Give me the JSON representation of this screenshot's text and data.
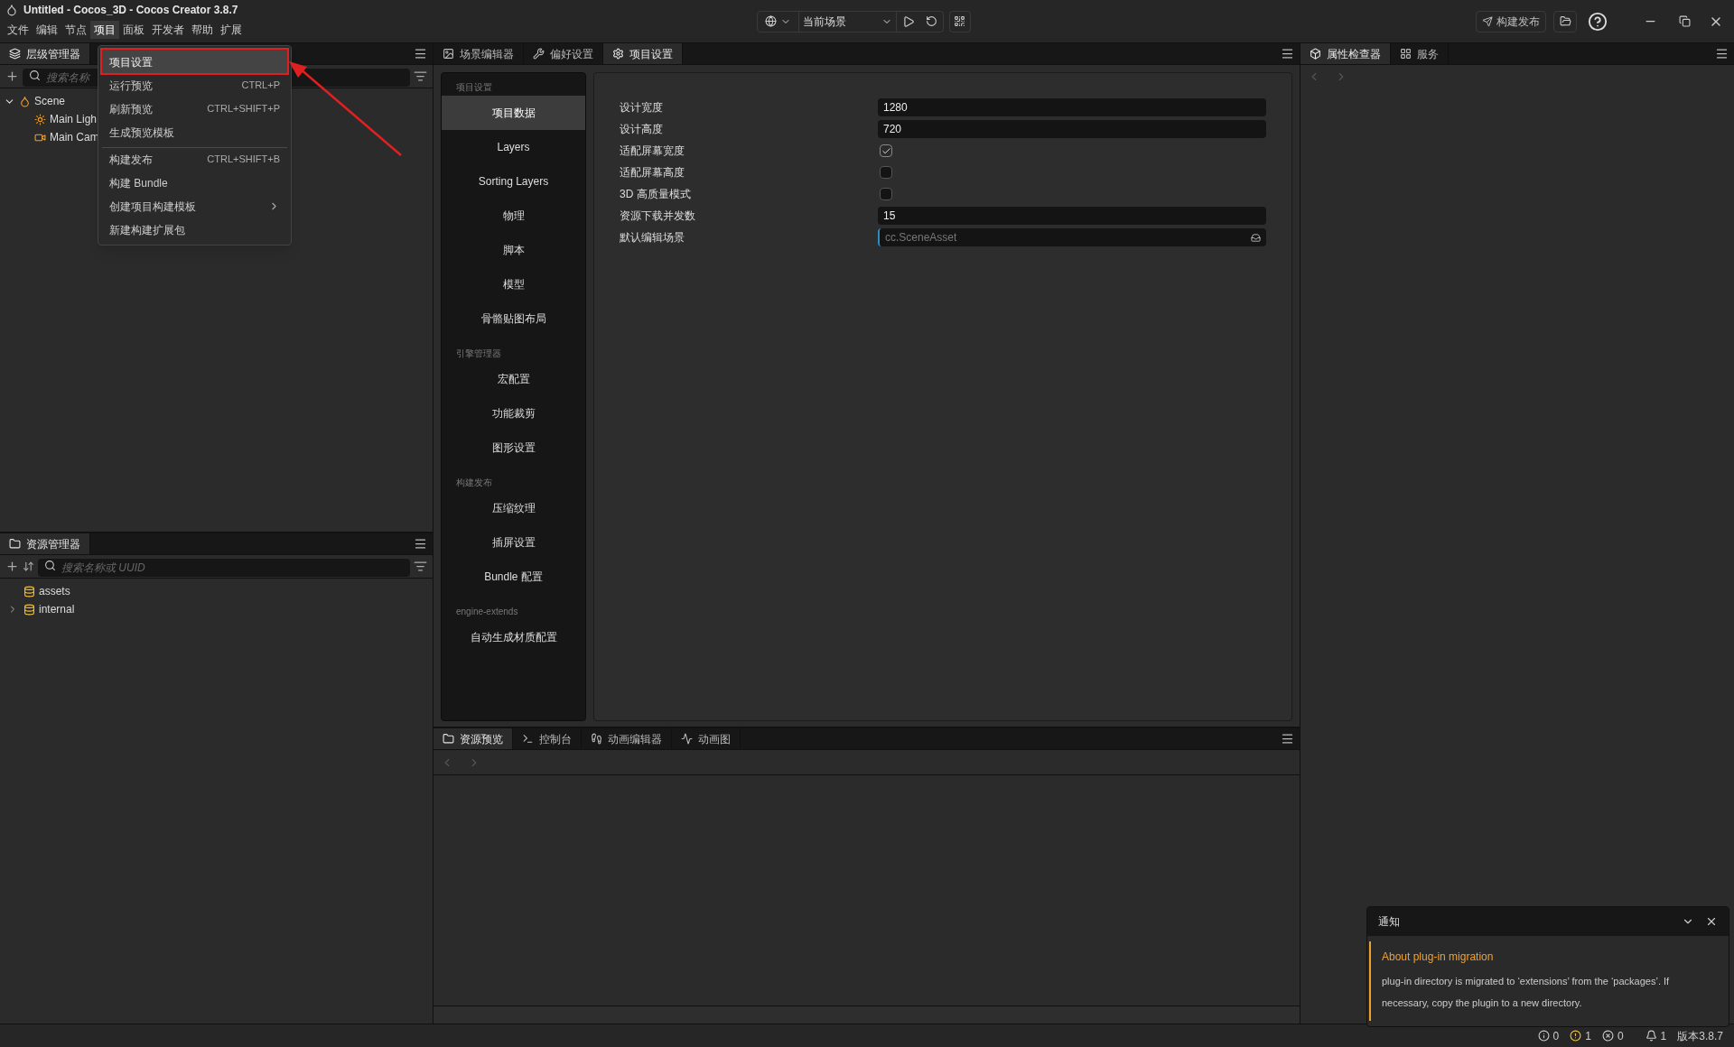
{
  "window": {
    "title": "Untitled - Cocos_3D - Cocos Creator 3.8.7"
  },
  "menu_bar": [
    {
      "label": "文件",
      "selected": false
    },
    {
      "label": "编辑",
      "selected": false
    },
    {
      "label": "节点",
      "selected": false
    },
    {
      "label": "项目",
      "selected": true
    },
    {
      "label": "面板",
      "selected": false
    },
    {
      "label": "开发者",
      "selected": false
    },
    {
      "label": "帮助",
      "selected": false
    },
    {
      "label": "扩展",
      "selected": false
    }
  ],
  "toolbar": {
    "scene_select": "当前场景",
    "build_button": "构建发布"
  },
  "project_menu": [
    {
      "label": "项目设置",
      "selected": true,
      "highlighted": true,
      "has_submenu": false,
      "separator_before": false
    },
    {
      "label": "运行预览",
      "shortcut": "CTRL+P",
      "selected": false,
      "highlighted": false,
      "has_submenu": false,
      "separator_before": false
    },
    {
      "label": "刷新预览",
      "shortcut": "CTRL+SHIFT+P",
      "selected": false,
      "highlighted": false,
      "has_submenu": false,
      "separator_before": false
    },
    {
      "label": "生成预览模板",
      "selected": false,
      "highlighted": false,
      "has_submenu": false,
      "separator_before": false
    },
    {
      "label": "构建发布",
      "shortcut": "CTRL+SHIFT+B",
      "selected": false,
      "highlighted": false,
      "has_submenu": false,
      "separator_before": true
    },
    {
      "label": "构建 Bundle",
      "selected": false,
      "highlighted": false,
      "has_submenu": false,
      "separator_before": false
    },
    {
      "label": "创建项目构建模板",
      "selected": false,
      "highlighted": false,
      "has_submenu": true,
      "separator_before": false
    },
    {
      "label": "新建构建扩展包",
      "selected": false,
      "highlighted": false,
      "has_submenu": false,
      "separator_before": false
    }
  ],
  "hierarchy": {
    "tabs": [
      {
        "label": "层级管理器",
        "selected": true
      }
    ],
    "search": {
      "placeholder": "搜索名称"
    },
    "tree": [
      {
        "label": "Scene",
        "kind": "scene",
        "expanded": true,
        "children": [
          {
            "label": "Main Ligh",
            "kind": "light"
          },
          {
            "label": "Main Cam",
            "kind": "camera"
          }
        ]
      }
    ]
  },
  "assets": {
    "tabs": [
      {
        "label": "资源管理器",
        "selected": true
      }
    ],
    "search": {
      "placeholder": "搜索名称或 UUID"
    },
    "tree": [
      {
        "label": "assets",
        "expandable": false
      },
      {
        "label": "internal",
        "expandable": true
      }
    ]
  },
  "editor": {
    "tabs": [
      {
        "label": "场景编辑器",
        "kind": "scene",
        "selected": false
      },
      {
        "label": "偏好设置",
        "kind": "prefs",
        "selected": false
      },
      {
        "label": "项目设置",
        "kind": "settings",
        "selected": true
      }
    ],
    "nav": [
      {
        "heading": "项目设置",
        "items": [
          {
            "label": "项目数据",
            "selected": true
          },
          {
            "label": "Layers",
            "selected": false
          },
          {
            "label": "Sorting Layers",
            "selected": false
          },
          {
            "label": "物理",
            "selected": false
          },
          {
            "label": "脚本",
            "selected": false
          },
          {
            "label": "模型",
            "selected": false
          },
          {
            "label": "骨骼贴图布局",
            "selected": false
          }
        ]
      },
      {
        "heading": "引擎管理器",
        "items": [
          {
            "label": "宏配置",
            "selected": false
          },
          {
            "label": "功能裁剪",
            "selected": false
          },
          {
            "label": "图形设置",
            "selected": false
          }
        ]
      },
      {
        "heading": "构建发布",
        "items": [
          {
            "label": "压缩纹理",
            "selected": false
          },
          {
            "label": "插屏设置",
            "selected": false
          },
          {
            "label": "Bundle 配置",
            "selected": false
          }
        ]
      },
      {
        "heading": "engine-extends",
        "items": [
          {
            "label": "自动生成材质配置",
            "selected": false
          }
        ]
      }
    ],
    "fields": [
      {
        "label": "设计宽度",
        "kind": "number",
        "value": "1280"
      },
      {
        "label": "设计高度",
        "kind": "number",
        "value": "720"
      },
      {
        "label": "适配屏幕宽度",
        "kind": "checkbox",
        "checked": true
      },
      {
        "label": "适配屏幕高度",
        "kind": "checkbox",
        "checked": false
      },
      {
        "label": "3D 高质量模式",
        "kind": "checkbox",
        "checked": false
      },
      {
        "label": "资源下载并发数",
        "kind": "number",
        "value": "15"
      },
      {
        "label": "默认编辑场景",
        "kind": "asset",
        "placeholder": "cc.SceneAsset"
      }
    ]
  },
  "bottom": {
    "tabs": [
      {
        "label": "资源预览",
        "kind": "preview",
        "selected": true
      },
      {
        "label": "控制台",
        "kind": "console",
        "selected": false
      },
      {
        "label": "动画编辑器",
        "kind": "animation",
        "selected": false
      },
      {
        "label": "动画图",
        "kind": "graph",
        "selected": false
      }
    ]
  },
  "inspector": {
    "tabs": [
      {
        "label": "属性检查器",
        "kind": "inspector",
        "selected": true
      },
      {
        "label": "服务",
        "kind": "services",
        "selected": false
      }
    ]
  },
  "notification": {
    "title": "通知",
    "heading": "About plug-in migration",
    "body": "plug-in directory is migrated to ‘extensions’ from the ‘packages’. If necessary, copy the plugin to a new directory."
  },
  "status_bar": {
    "counts": [
      {
        "kind": "info",
        "value": "0"
      },
      {
        "kind": "warning",
        "value": "1"
      },
      {
        "kind": "error",
        "value": "0"
      },
      {
        "kind": "bell",
        "value": "1"
      }
    ],
    "version": "版本3.8.7"
  }
}
